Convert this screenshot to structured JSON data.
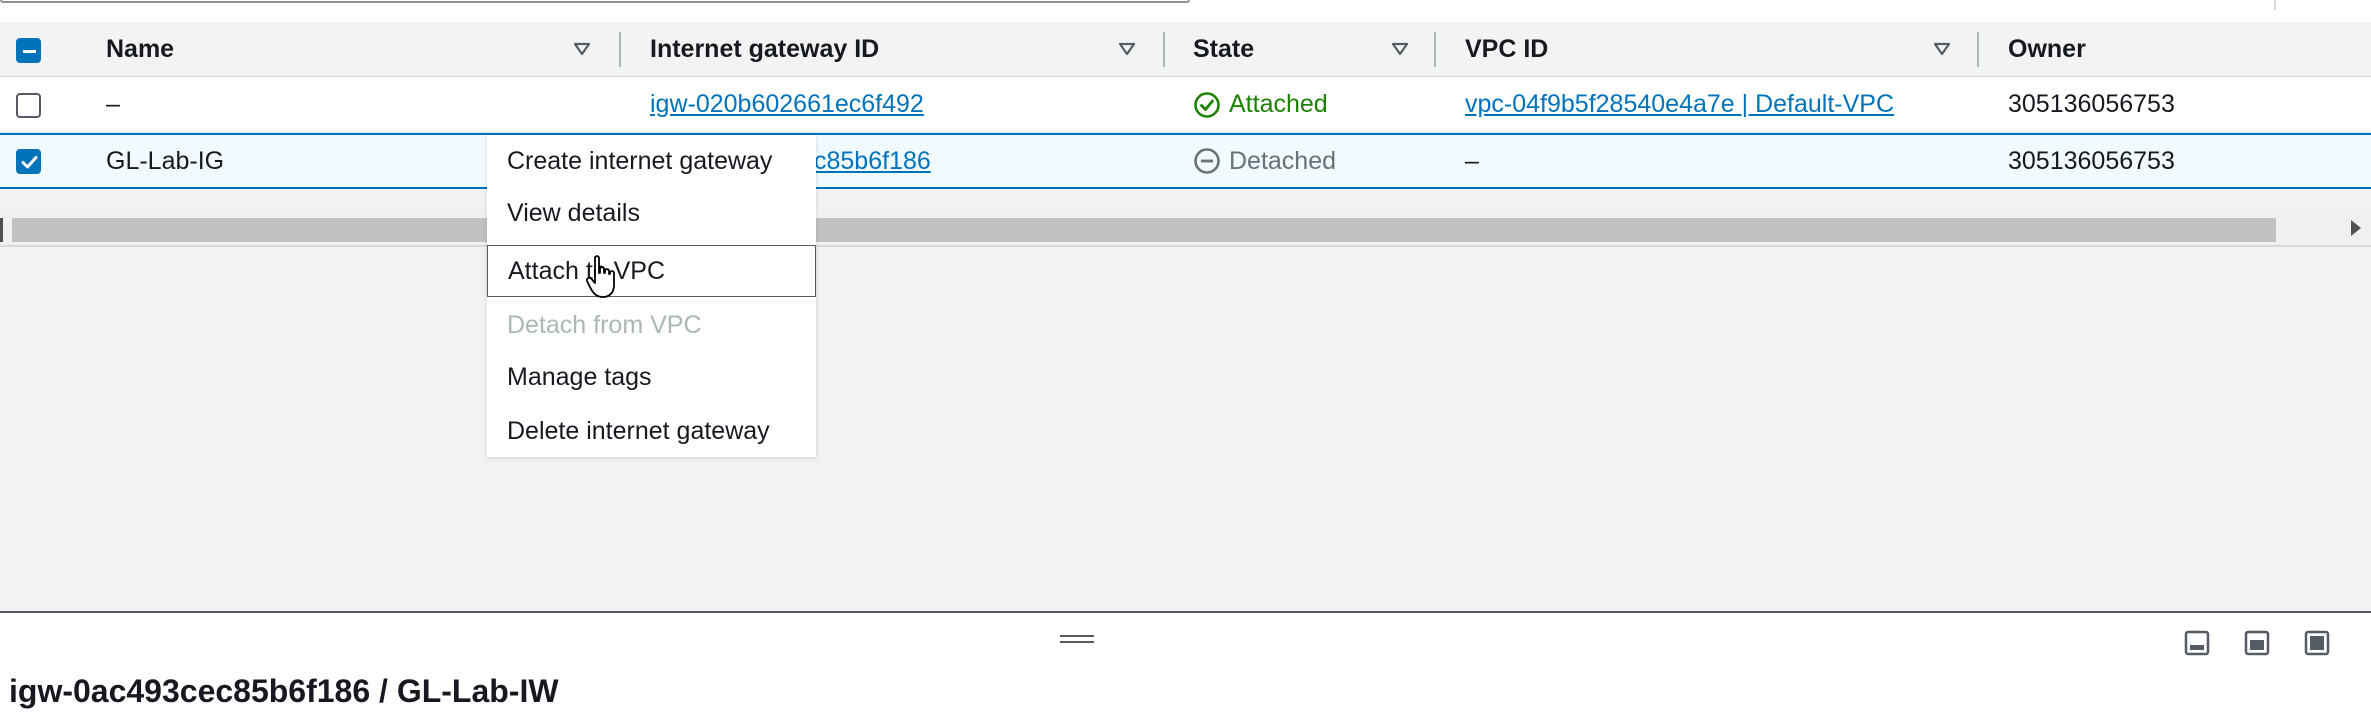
{
  "table": {
    "headers": {
      "name": "Name",
      "gateway_id": "Internet gateway ID",
      "state": "State",
      "vpc_id": "VPC ID",
      "owner": "Owner"
    },
    "rows": [
      {
        "selected": false,
        "name": "–",
        "gateway_id": "igw-020b602661ec6f492",
        "state": "Attached",
        "state_icon": "check-circle-icon",
        "vpc_id": "vpc-04f9b5f28540e4a7e | Default-VPC",
        "owner": "305136056753"
      },
      {
        "selected": true,
        "name": "GL-Lab-IG",
        "gateway_id_visible": "c85b6f186",
        "state": "Detached",
        "state_icon": "minus-circle-icon",
        "vpc_id": "–",
        "owner": "305136056753"
      }
    ]
  },
  "context_menu": {
    "items": [
      {
        "label": "Create internet gateway",
        "disabled": false
      },
      {
        "label": "View details",
        "disabled": false
      },
      {
        "label": "Attach to VPC",
        "disabled": false,
        "hovered": true
      },
      {
        "label": "Detach from VPC",
        "disabled": true
      },
      {
        "label": "Manage tags",
        "disabled": false
      },
      {
        "label": "Delete internet gateway",
        "disabled": false
      }
    ]
  },
  "details": {
    "title": "igw-0ac493cec85b6f186 / GL-Lab-IW"
  },
  "colors": {
    "link": "#0073bb",
    "success": "#1d8102",
    "muted": "#687078",
    "selection": "#0073bb"
  }
}
